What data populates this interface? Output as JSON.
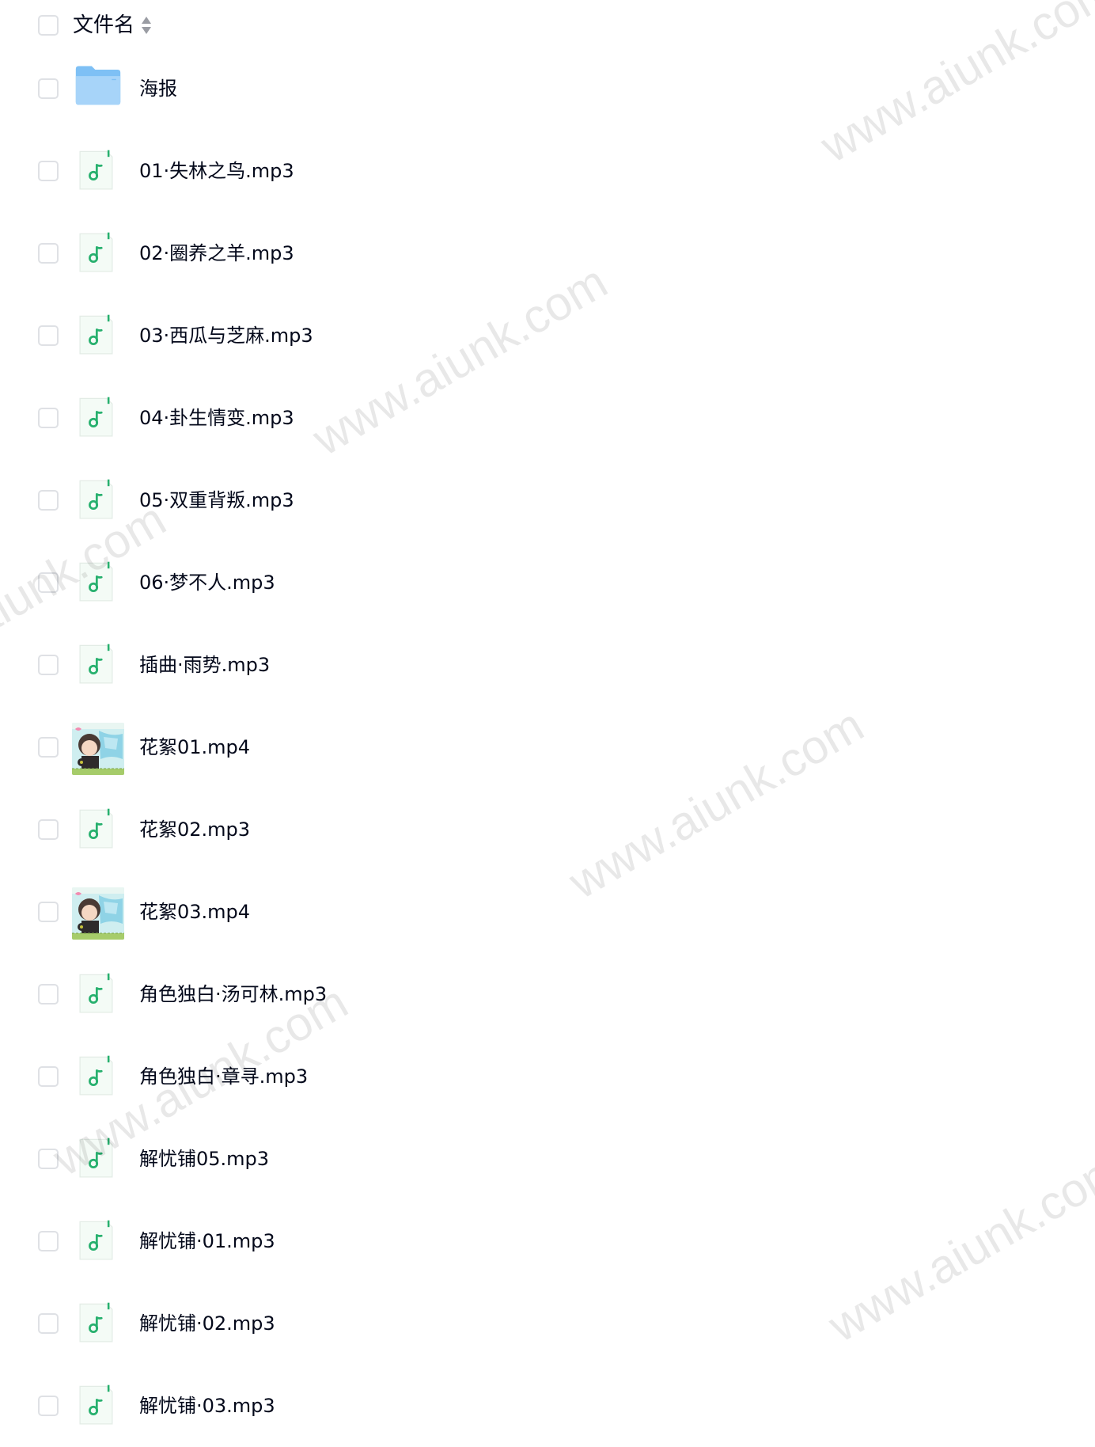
{
  "header": {
    "column_label": "文件名",
    "sort_icon": "sort-updown-icon"
  },
  "files": [
    {
      "name": "海报",
      "type": "folder",
      "icon": "folder-icon"
    },
    {
      "name": "01·失林之鸟.mp3",
      "type": "audio",
      "icon": "music-note-icon"
    },
    {
      "name": "02·圈养之羊.mp3",
      "type": "audio",
      "icon": "music-note-icon"
    },
    {
      "name": "03·西瓜与芝麻.mp3",
      "type": "audio",
      "icon": "music-note-icon"
    },
    {
      "name": "04·卦生情变.mp3",
      "type": "audio",
      "icon": "music-note-icon"
    },
    {
      "name": "05·双重背叛.mp3",
      "type": "audio",
      "icon": "music-note-icon"
    },
    {
      "name": "06·梦不人.mp3",
      "type": "audio",
      "icon": "music-note-icon"
    },
    {
      "name": "插曲·雨势.mp3",
      "type": "audio",
      "icon": "music-note-icon"
    },
    {
      "name": "花絮01.mp4",
      "type": "video",
      "icon": "video-thumbnail"
    },
    {
      "name": "花絮02.mp3",
      "type": "audio",
      "icon": "music-note-icon"
    },
    {
      "name": "花絮03.mp4",
      "type": "video",
      "icon": "video-thumbnail"
    },
    {
      "name": "角色独白·汤可林.mp3",
      "type": "audio",
      "icon": "music-note-icon"
    },
    {
      "name": "角色独白·章寻.mp3",
      "type": "audio",
      "icon": "music-note-icon"
    },
    {
      "name": "解忧铺05.mp3",
      "type": "audio",
      "icon": "music-note-icon"
    },
    {
      "name": "解忧铺·01.mp3",
      "type": "audio",
      "icon": "music-note-icon"
    },
    {
      "name": "解忧铺·02.mp3",
      "type": "audio",
      "icon": "music-note-icon"
    },
    {
      "name": "解忧铺·03.mp3",
      "type": "audio",
      "icon": "music-note-icon"
    }
  ],
  "watermark_text": "www.aiunk.com",
  "colors": {
    "text": "#03081a",
    "checkbox_border": "#dfe1e5",
    "audio_accent": "#27b06e",
    "folder_blue": "#7ec0f5"
  }
}
